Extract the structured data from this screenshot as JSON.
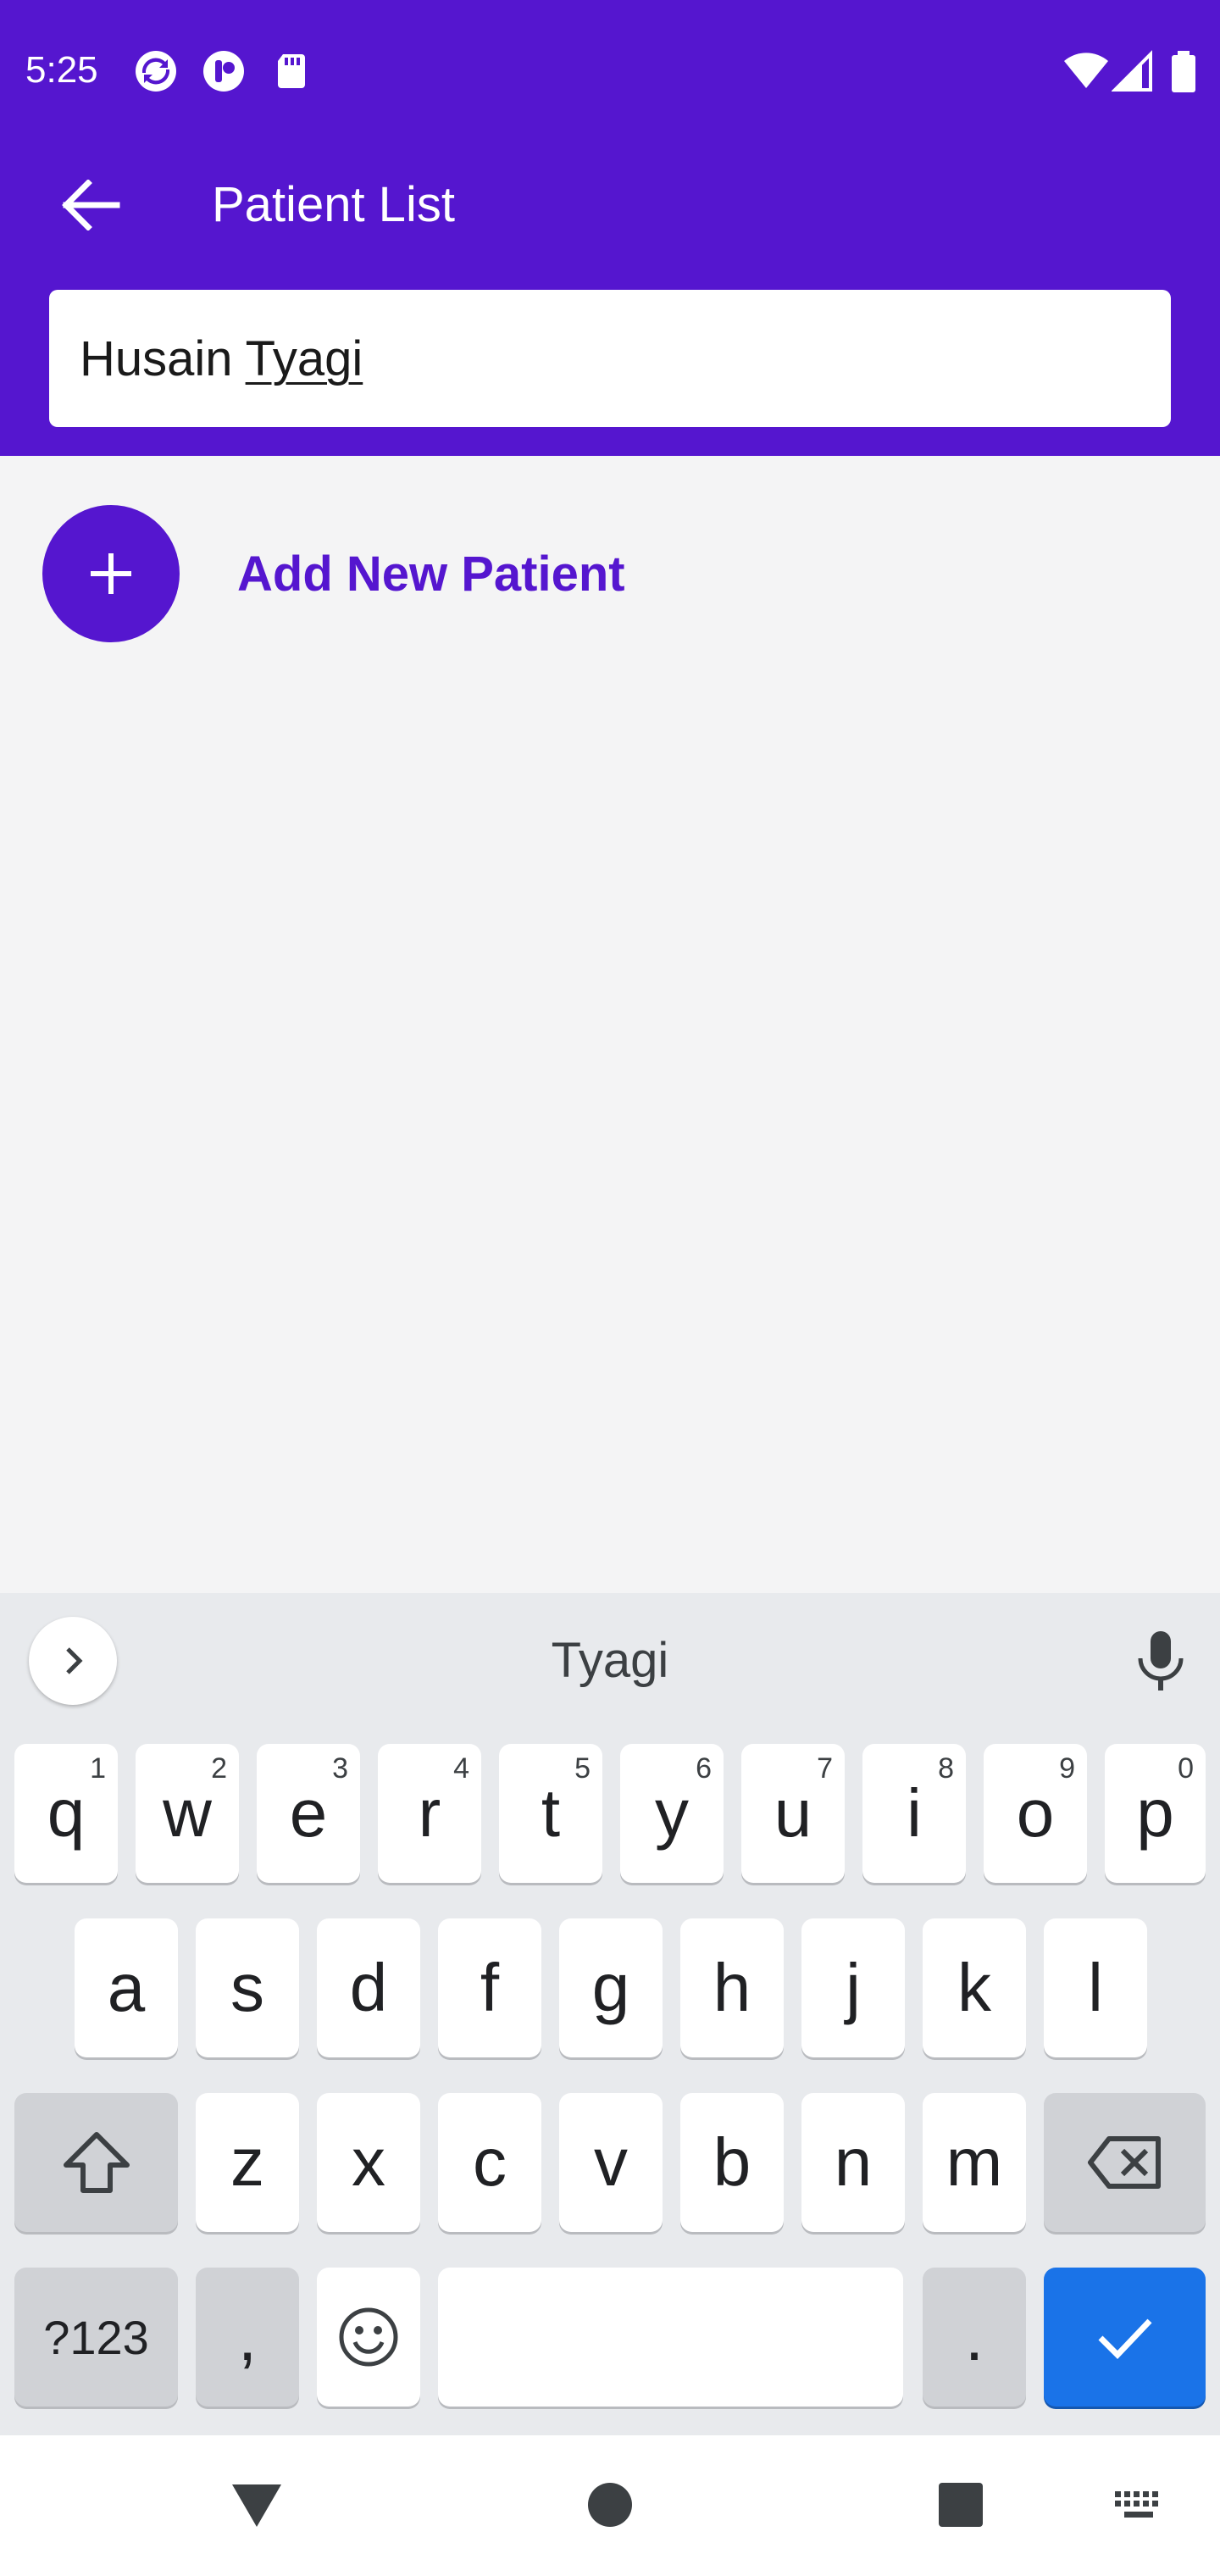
{
  "status_bar": {
    "time": "5:25",
    "left_icons": [
      "sync-icon",
      "app-icon",
      "sd-card-icon"
    ],
    "right_icons": [
      "wifi-icon",
      "signal-icon",
      "battery-icon"
    ]
  },
  "toolbar": {
    "back_icon": "arrow-left-icon",
    "title": "Patient List"
  },
  "search": {
    "value_first": "Husain ",
    "value_composing": "Tyagi"
  },
  "add_patient": {
    "icon": "plus-icon",
    "label": "Add New Patient"
  },
  "keyboard": {
    "suggestion": "Tyagi",
    "row1": [
      {
        "k": "q",
        "h": "1"
      },
      {
        "k": "w",
        "h": "2"
      },
      {
        "k": "e",
        "h": "3"
      },
      {
        "k": "r",
        "h": "4"
      },
      {
        "k": "t",
        "h": "5"
      },
      {
        "k": "y",
        "h": "6"
      },
      {
        "k": "u",
        "h": "7"
      },
      {
        "k": "i",
        "h": "8"
      },
      {
        "k": "o",
        "h": "9"
      },
      {
        "k": "p",
        "h": "0"
      }
    ],
    "row2": [
      "a",
      "s",
      "d",
      "f",
      "g",
      "h",
      "j",
      "k",
      "l"
    ],
    "row3": [
      "z",
      "x",
      "c",
      "v",
      "b",
      "n",
      "m"
    ],
    "symbols_label": "?123",
    "comma_label": ",",
    "period_label": ".",
    "accent_color": "#1a73e8"
  },
  "colors": {
    "primary": "#5516cf",
    "background": "#f4f4f5"
  }
}
